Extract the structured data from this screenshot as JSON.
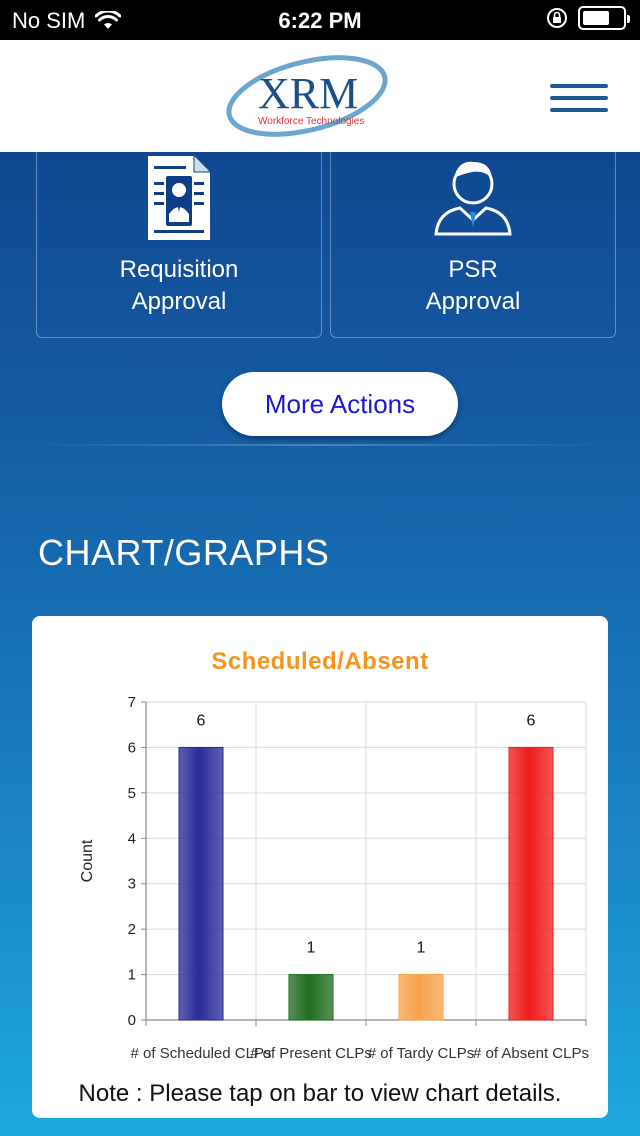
{
  "status_bar": {
    "carrier": "No SIM",
    "time": "6:22 PM"
  },
  "header": {
    "logo_text": "XRM",
    "logo_subtext": "Workforce Technologies"
  },
  "actions": {
    "tiles": [
      {
        "line1": "Requisition",
        "line2": "Approval",
        "icon": "requisition-icon"
      },
      {
        "line1": "PSR",
        "line2": "Approval",
        "icon": "psr-icon"
      }
    ],
    "more_label": "More Actions"
  },
  "section": {
    "title": "CHART/GRAPHS"
  },
  "chart_note": "Note : Please tap on bar to view chart details.",
  "colors": {
    "title": "#f7941d",
    "bar1": "#2a2a9a",
    "bar2": "#1f6e1f",
    "bar3": "#f7a24a",
    "bar4": "#ee1c1c"
  },
  "chart_data": {
    "type": "bar",
    "title": "Scheduled/Absent",
    "ylabel": "Count",
    "xlabel": "",
    "ylim": [
      0,
      7
    ],
    "yticks": [
      0,
      1,
      2,
      3,
      4,
      5,
      6,
      7
    ],
    "categories": [
      "# of Scheduled CLPs",
      "# of Present CLPs",
      "# of Tardy CLPs",
      "# of Absent CLPs"
    ],
    "values": [
      6,
      1,
      1,
      6
    ],
    "grid": true
  }
}
